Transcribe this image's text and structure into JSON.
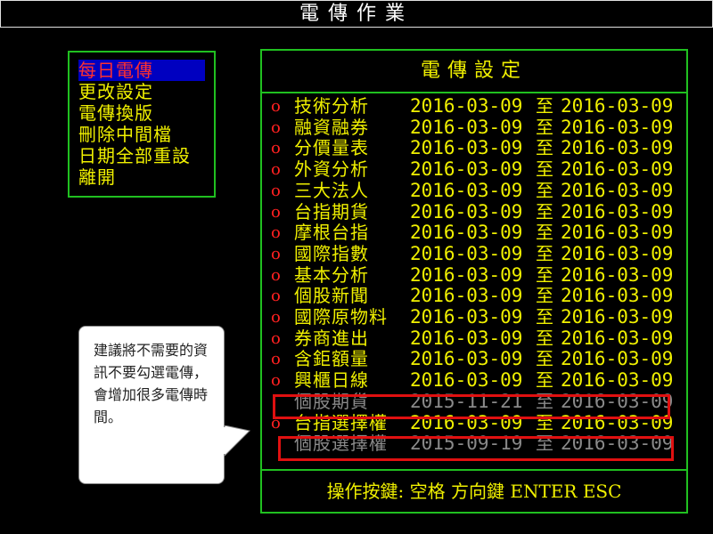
{
  "window": {
    "title": "電傳作業"
  },
  "menu": {
    "items": [
      {
        "label": "每日電傳",
        "selected": true
      },
      {
        "label": "更改設定",
        "selected": false
      },
      {
        "label": "電傳換版",
        "selected": false
      },
      {
        "label": "刪除中間檔",
        "selected": false
      },
      {
        "label": "日期全部重設",
        "selected": false
      },
      {
        "label": "離開",
        "selected": false
      }
    ]
  },
  "panel": {
    "title": "電傳設定",
    "range_word": "至",
    "mark": "o",
    "rows": [
      {
        "label": "技術分析",
        "from": "2016-03-09",
        "to": "2016-03-09",
        "checked": true
      },
      {
        "label": "融資融券",
        "from": "2016-03-09",
        "to": "2016-03-09",
        "checked": true
      },
      {
        "label": "分價量表",
        "from": "2016-03-09",
        "to": "2016-03-09",
        "checked": true
      },
      {
        "label": "外資分析",
        "from": "2016-03-09",
        "to": "2016-03-09",
        "checked": true
      },
      {
        "label": "三大法人",
        "from": "2016-03-09",
        "to": "2016-03-09",
        "checked": true
      },
      {
        "label": "台指期貨",
        "from": "2016-03-09",
        "to": "2016-03-09",
        "checked": true
      },
      {
        "label": "摩根台指",
        "from": "2016-03-09",
        "to": "2016-03-09",
        "checked": true
      },
      {
        "label": "國際指數",
        "from": "2016-03-09",
        "to": "2016-03-09",
        "checked": true
      },
      {
        "label": "基本分析",
        "from": "2016-03-09",
        "to": "2016-03-09",
        "checked": true
      },
      {
        "label": "個股新聞",
        "from": "2016-03-09",
        "to": "2016-03-09",
        "checked": true
      },
      {
        "label": "國際原物料",
        "from": "2016-03-09",
        "to": "2016-03-09",
        "checked": true
      },
      {
        "label": "券商進出",
        "from": "2016-03-09",
        "to": "2016-03-09",
        "checked": true
      },
      {
        "label": "含鉅額量",
        "from": "2016-03-09",
        "to": "2016-03-09",
        "checked": true
      },
      {
        "label": "興櫃日線",
        "from": "2016-03-09",
        "to": "2016-03-09",
        "checked": true
      },
      {
        "label": "個股期貨",
        "from": "2015-11-21",
        "to": "2016-03-09",
        "checked": false
      },
      {
        "label": "台指選擇權",
        "from": "2016-03-09",
        "to": "2016-03-09",
        "checked": true
      },
      {
        "label": "個股選擇權",
        "from": "2015-09-19",
        "to": "2016-03-09",
        "checked": false
      }
    ],
    "footer": "操作按鍵: 空格 方向鍵 ENTER ESC"
  },
  "callout": {
    "text": "建議將不需要的資訊不要勾選電傳，會增加很多電傳時間。"
  },
  "colors": {
    "background": "#000000",
    "text": "#f0f000",
    "border": "#20c020",
    "mark": "#ff2020",
    "selection_bg": "#0000c0",
    "disabled_text": "#8a8a8a",
    "highlight": "#e01010"
  }
}
